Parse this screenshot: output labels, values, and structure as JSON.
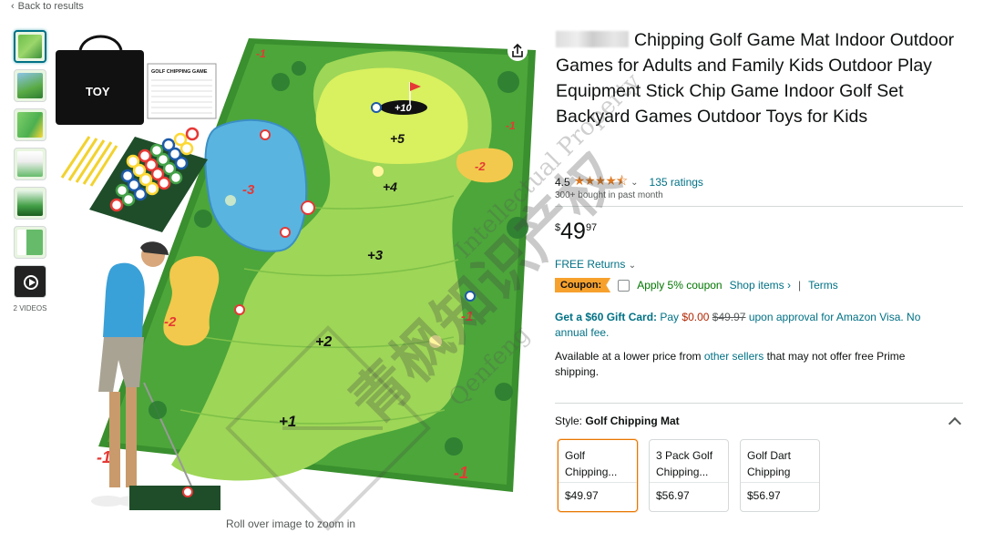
{
  "nav": {
    "back_label": "Back to results",
    "back_icon": "chevron-left-icon"
  },
  "gallery": {
    "videos_label": "2 VIDEOS",
    "zoom_hint": "Roll over image to zoom in",
    "main_image": {
      "bag_brand": "TOY",
      "scorecard_title": "GOLF CHIPPING GAME",
      "hole_label": "+10",
      "zones": [
        "+5",
        "+4",
        "+3",
        "+2",
        "+1",
        "-3",
        "-2",
        "-2",
        "-1",
        "-1",
        "-1",
        "-1",
        "-1"
      ]
    }
  },
  "watermark": {
    "chinese": "青枫知识产权",
    "pinyin": "Qenfeng",
    "english": "Intellectual Property"
  },
  "product": {
    "title": "Chipping Golf Game Mat Indoor Outdoor Games for Adults and Family Kids Outdoor Play Equipment Stick Chip Game Indoor Golf Set Backyard Games Outdoor Toys for Kids",
    "rating_value": "4.5",
    "stars": "★★★★⯪",
    "rating_count": "135 ratings",
    "bought": "300+ bought in past month",
    "price": {
      "symbol": "$",
      "whole": "49",
      "fraction": "97"
    },
    "returns": "FREE Returns",
    "coupon": {
      "tag": "Coupon:",
      "text": "Apply 5% coupon",
      "shop_link": "Shop items ›",
      "separator": "|",
      "terms": "Terms"
    },
    "gift": {
      "bold": "Get a $60 Gift Card:",
      "pay": "Pay",
      "pay_amount": "$0.00",
      "strike": "$49.97",
      "rest": "upon approval for Amazon Visa. No annual fee."
    },
    "lower_price": {
      "before": "Available at a lower price from",
      "link": "other sellers",
      "after": "that may not offer free Prime shipping."
    },
    "style": {
      "label": "Style:",
      "selected": "Golf Chipping Mat",
      "options": [
        {
          "name": "Golf Chipping...",
          "price": "$49.97"
        },
        {
          "name": "3 Pack Golf Chipping...",
          "price": "$56.97"
        },
        {
          "name": "Golf Dart Chipping",
          "price": "$56.97"
        }
      ]
    }
  },
  "colors": {
    "link": "#007185",
    "price_red": "#b12704",
    "star": "#de7921",
    "coupon_bg": "#f7a12d",
    "selected_border": "#e77600"
  }
}
